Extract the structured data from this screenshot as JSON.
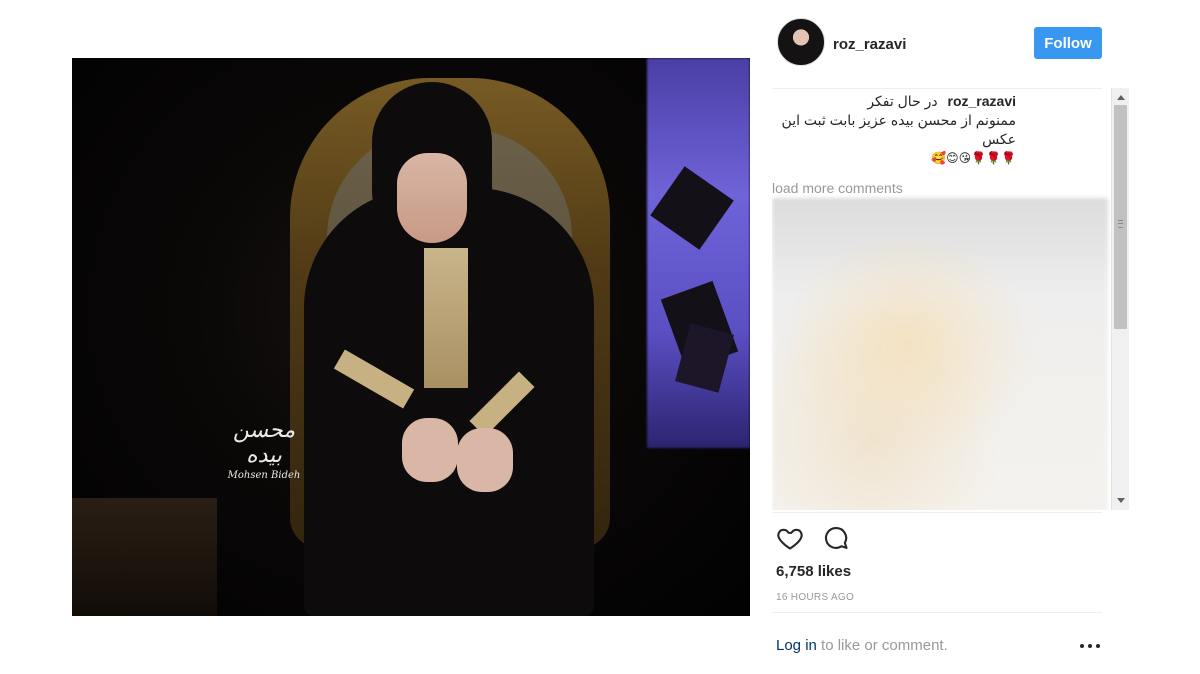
{
  "post": {
    "image_alt": "Woman in black outfit seated on a gilded chair on a dark stage",
    "watermark_signature": "محسن بیده",
    "watermark_name": "Mohsen Bideh"
  },
  "header": {
    "username": "roz_razavi",
    "follow_label": "Follow"
  },
  "caption": {
    "username": "roz_razavi",
    "line1": "در حال تفکر",
    "line2": "ممنونم از محسن بیده عزیز بابت ثبت این عکس",
    "emojis": "🌹🌹🌹😘😊🥰"
  },
  "comments": {
    "load_more_label": "load more comments"
  },
  "actions": {
    "like_icon": "heart-outline-icon",
    "comment_icon": "comment-bubble-icon"
  },
  "stats": {
    "likes": "6,758 likes",
    "time": "16 HOURS AGO"
  },
  "footer": {
    "login_link": "Log in",
    "login_rest": " to like or comment.",
    "more_icon": "more-options-icon"
  },
  "colors": {
    "follow_button": "#3897f0",
    "link": "#003569",
    "muted": "#999999"
  }
}
